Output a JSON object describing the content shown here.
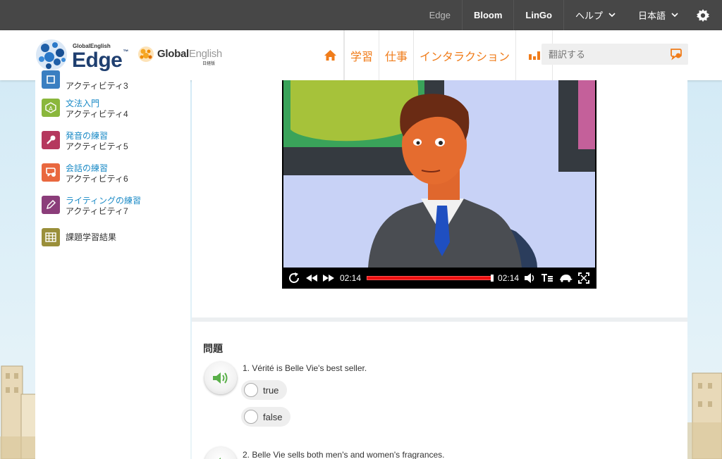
{
  "topbar": {
    "items": [
      {
        "label": "Edge"
      },
      {
        "label": "Bloom"
      },
      {
        "label": "LinGo"
      },
      {
        "label": "ヘルプ"
      },
      {
        "label": "日本語"
      }
    ]
  },
  "header": {
    "logo_edge": {
      "small": "GlobalEnglish",
      "big": "Edge"
    },
    "logo_ge": {
      "name_a": "Global",
      "name_b": "English",
      "sub": "日経版"
    },
    "nav": {
      "learn": "学習",
      "work": "仕事",
      "interaction": "インタラクション"
    },
    "search": {
      "placeholder": "翻訳する"
    }
  },
  "sidebar": {
    "activities": [
      {
        "title": "",
        "sub": "アクティビティ3",
        "color": "#3a7fc1",
        "icon": "partial-icon"
      },
      {
        "title": "文法入門",
        "sub": "アクティビティ4",
        "color": "#8ab73c",
        "icon": "grammar-icon"
      },
      {
        "title": "発音の練習",
        "sub": "アクティビティ5",
        "color": "#b5385e",
        "icon": "pronunciation-icon"
      },
      {
        "title": "会話の練習",
        "sub": "アクティビティ6",
        "color": "#e9683f",
        "icon": "conversation-icon"
      },
      {
        "title": "ライティングの練習",
        "sub": "アクティビティ7",
        "color": "#8b3d7a",
        "icon": "writing-icon"
      },
      {
        "title": "課題学習結果",
        "sub": "",
        "color": "#9a8f3a",
        "icon": "results-grid-icon"
      }
    ]
  },
  "video": {
    "elapsed": "02:14",
    "duration": "02:14",
    "progress": 1.0
  },
  "questions": {
    "title": "問題",
    "items": [
      {
        "text": "1. Vérité is Belle Vie's best seller.",
        "options": [
          "true",
          "false"
        ]
      },
      {
        "text": "2. Belle Vie sells both men's and women's fragrances."
      }
    ]
  },
  "colors": {
    "accent": "#f07c1a",
    "link": "#1a8ac6",
    "topbar": "#474747"
  }
}
